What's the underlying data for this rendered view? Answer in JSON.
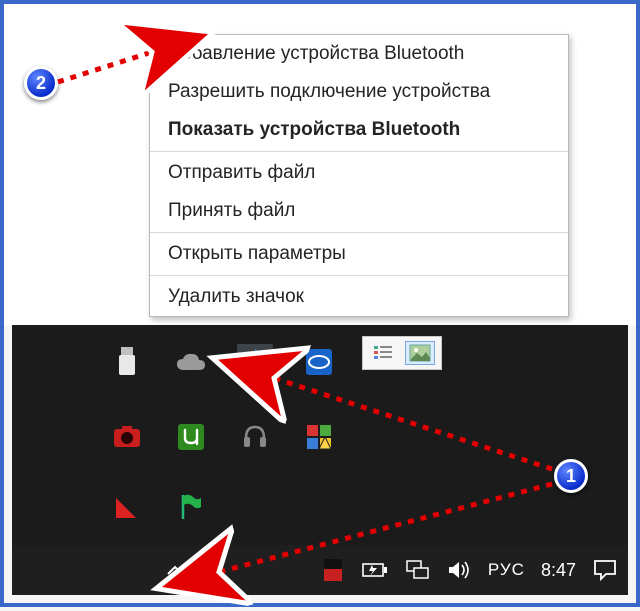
{
  "context_menu": {
    "items": [
      {
        "label": "Добавление устройства Bluetooth",
        "bold": false
      },
      {
        "label": "Разрешить подключение устройства",
        "bold": false
      },
      {
        "label": "Показать устройства Bluetooth",
        "bold": true
      }
    ],
    "items2": [
      {
        "label": "Отправить файл"
      },
      {
        "label": "Принять файл"
      }
    ],
    "items3": [
      {
        "label": "Открыть параметры"
      }
    ],
    "items4": [
      {
        "label": "Удалить значок"
      }
    ]
  },
  "tray_icons": {
    "row1": [
      "usb",
      "onedrive",
      "bluetooth",
      "intel"
    ],
    "row2": [
      "camera",
      "utorrent",
      "headset",
      "security"
    ],
    "row3": [
      "triangle",
      "flag"
    ]
  },
  "taskbar": {
    "language": "РУС",
    "time": "8:47"
  },
  "annotations": {
    "badge1": "1",
    "badge2": "2"
  }
}
